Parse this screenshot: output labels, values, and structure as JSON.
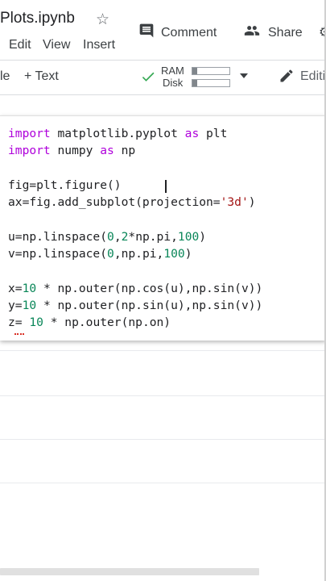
{
  "header": {
    "filename": "Plots.ipynb",
    "comment_label": "Comment",
    "share_label": "Share"
  },
  "menu": [
    "Edit",
    "View",
    "Insert"
  ],
  "toolbar": {
    "code_partial": "le",
    "text_button": "+ Text",
    "ram_label": "RAM",
    "disk_label": "Disk",
    "editing_label": "Editi",
    "ram_level": 0.12,
    "disk_level": 0.12
  },
  "cell": {
    "lines": [
      [
        {
          "t": "import",
          "c": "kw"
        },
        {
          "t": " matplotlib.pyplot "
        },
        {
          "t": "as",
          "c": "kw"
        },
        {
          "t": " plt"
        }
      ],
      [
        {
          "t": "import",
          "c": "kw"
        },
        {
          "t": " numpy "
        },
        {
          "t": "as",
          "c": "kw"
        },
        {
          "t": " np"
        }
      ],
      [],
      [
        {
          "t": "fig=plt.figure()"
        }
      ],
      [
        {
          "t": "ax=fig.add_subplot(projection="
        },
        {
          "t": "'3d'",
          "c": "str"
        },
        {
          "t": ")"
        }
      ],
      [],
      [
        {
          "t": "u=np.linspace("
        },
        {
          "t": "0",
          "c": "num"
        },
        {
          "t": ","
        },
        {
          "t": "2",
          "c": "num"
        },
        {
          "t": "*np.pi,"
        },
        {
          "t": "100",
          "c": "num"
        },
        {
          "t": ")"
        }
      ],
      [
        {
          "t": "v=np.linspace("
        },
        {
          "t": "0",
          "c": "num"
        },
        {
          "t": ",np.pi,"
        },
        {
          "t": "100",
          "c": "num"
        },
        {
          "t": ")"
        }
      ],
      [],
      [
        {
          "t": "x="
        },
        {
          "t": "10",
          "c": "num"
        },
        {
          "t": " * np.outer(np.cos(u),np.sin(v))"
        }
      ],
      [
        {
          "t": "y="
        },
        {
          "t": "10",
          "c": "num"
        },
        {
          "t": " * np.outer(np.sin(u),np.sin(v))"
        }
      ],
      [
        {
          "t": "z= "
        },
        {
          "t": "10",
          "c": "num"
        },
        {
          "t": " * np.outer(np.on)"
        }
      ]
    ]
  }
}
